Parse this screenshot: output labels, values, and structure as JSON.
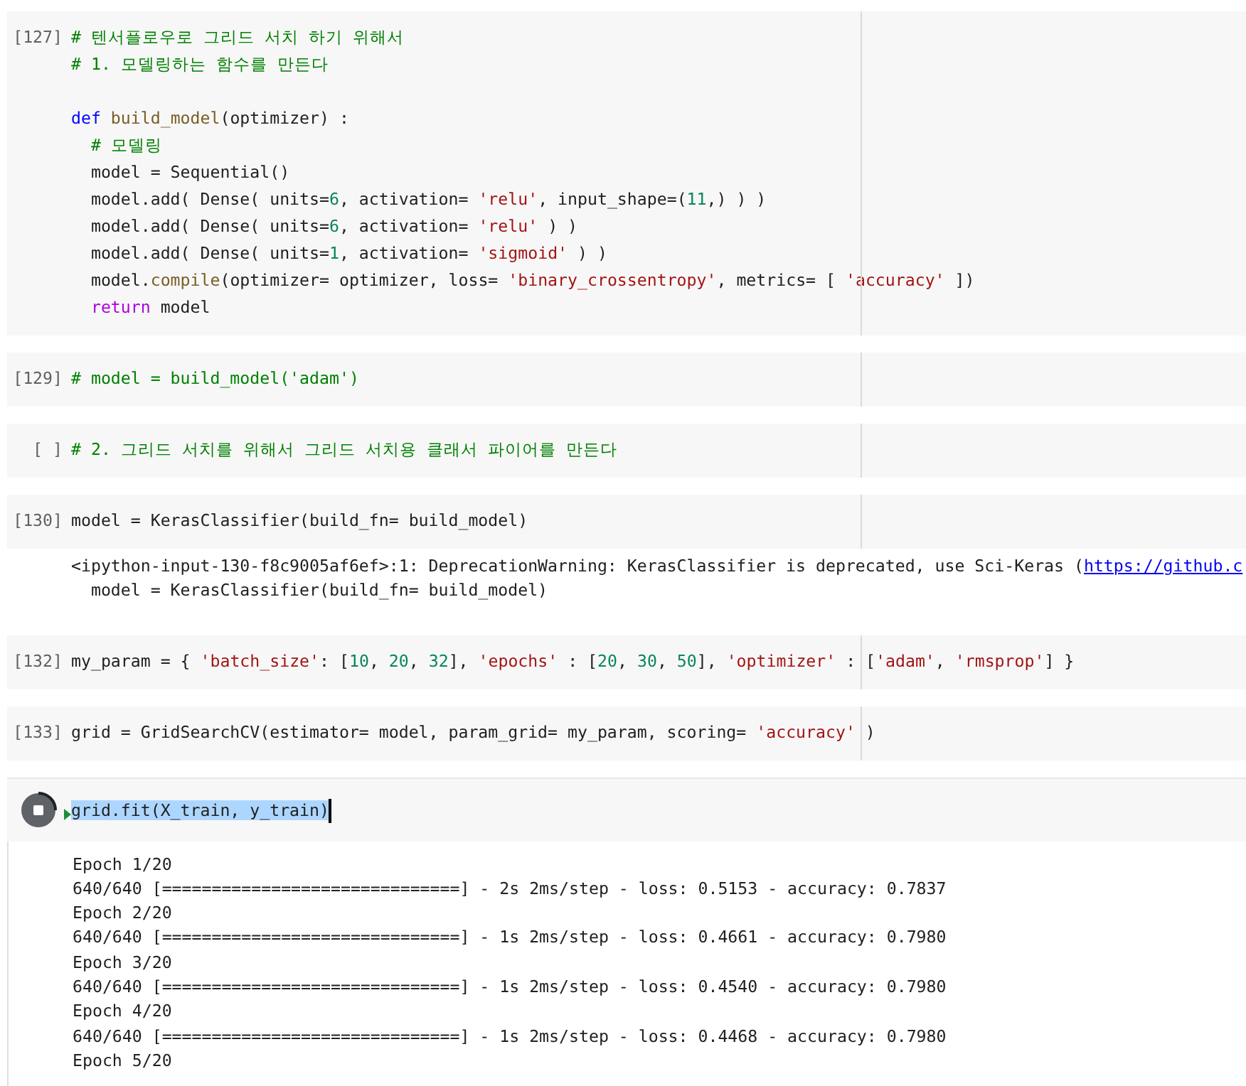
{
  "cells": [
    {
      "prompt": "[127]",
      "running": false,
      "lines": [
        {
          "tokens": [
            {
              "t": "# 텐서플로우로 그리드 서치 하기 위해서",
              "kind": "comment"
            }
          ]
        },
        {
          "tokens": [
            {
              "t": "# 1. 모델링하는 함수를 만든다",
              "kind": "comment"
            }
          ]
        },
        {
          "blank_before": true,
          "tokens": [
            {
              "t": "def",
              "kind": "keyword"
            },
            {
              "t": " build_model",
              "kind": "func"
            },
            {
              "t": "(optimizer) :",
              "kind": "plain"
            }
          ]
        },
        {
          "tokens": [
            {
              "t": "  # 모델링",
              "kind": "comment"
            }
          ]
        },
        {
          "tokens": [
            {
              "t": "  model = Sequential()",
              "kind": "plain"
            }
          ]
        },
        {
          "tokens": [
            {
              "t": "  model.add( Dense( units=",
              "kind": "plain"
            },
            {
              "t": "6",
              "kind": "number"
            },
            {
              "t": ", activation= ",
              "kind": "plain"
            },
            {
              "t": "'relu'",
              "kind": "string"
            },
            {
              "t": ", input_shape=(",
              "kind": "plain"
            },
            {
              "t": "11",
              "kind": "number"
            },
            {
              "t": ",) ) )",
              "kind": "plain"
            }
          ]
        },
        {
          "tokens": [
            {
              "t": "  model.add( Dense( units=",
              "kind": "plain"
            },
            {
              "t": "6",
              "kind": "number"
            },
            {
              "t": ", activation= ",
              "kind": "plain"
            },
            {
              "t": "'relu'",
              "kind": "string"
            },
            {
              "t": " ) )",
              "kind": "plain"
            }
          ]
        },
        {
          "tokens": [
            {
              "t": "  model.add( Dense( units=",
              "kind": "plain"
            },
            {
              "t": "1",
              "kind": "number"
            },
            {
              "t": ", activation= ",
              "kind": "plain"
            },
            {
              "t": "'sigmoid'",
              "kind": "string"
            },
            {
              "t": " ) )",
              "kind": "plain"
            }
          ]
        },
        {
          "tokens": [
            {
              "t": "  model.",
              "kind": "plain"
            },
            {
              "t": "compile",
              "kind": "func"
            },
            {
              "t": "(optimizer= optimizer, loss= ",
              "kind": "plain"
            },
            {
              "t": "'binary_crossentropy'",
              "kind": "string"
            },
            {
              "t": ", metrics= [ ",
              "kind": "plain"
            },
            {
              "t": "'accuracy'",
              "kind": "string"
            },
            {
              "t": " ])",
              "kind": "plain"
            }
          ]
        },
        {
          "tokens": [
            {
              "t": "  return",
              "kind": "return"
            },
            {
              "t": " model",
              "kind": "plain"
            }
          ]
        }
      ]
    },
    {
      "prompt": "[129]",
      "running": false,
      "lines": [
        {
          "tokens": [
            {
              "t": "# model = build_model('adam')",
              "kind": "comment"
            }
          ]
        }
      ]
    },
    {
      "prompt": "[ ]",
      "running": false,
      "lines": [
        {
          "tokens": [
            {
              "t": "# 2. 그리드 서치를 위해서 그리드 서치용 클래서 파이어를 만든다",
              "kind": "comment"
            }
          ]
        }
      ]
    },
    {
      "prompt": "[130]",
      "running": false,
      "lines": [
        {
          "tokens": [
            {
              "t": "model = KerasClassifier(build_fn= build_model)",
              "kind": "plain"
            }
          ]
        }
      ],
      "output": [
        [
          {
            "t": "<ipython-input-130-f8c9005af6ef>:1: DeprecationWarning: KerasClassifier is deprecated, use Sci-Keras (",
            "kind": "plain"
          },
          {
            "t": "https://github.c",
            "kind": "link"
          }
        ],
        [
          {
            "t": "  model = KerasClassifier(build_fn= build_model)",
            "kind": "plain"
          }
        ]
      ]
    },
    {
      "prompt": "[132]",
      "running": false,
      "lines": [
        {
          "tokens": [
            {
              "t": "my_param = { ",
              "kind": "plain"
            },
            {
              "t": "'batch_size'",
              "kind": "string"
            },
            {
              "t": ": [",
              "kind": "plain"
            },
            {
              "t": "10",
              "kind": "number"
            },
            {
              "t": ", ",
              "kind": "plain"
            },
            {
              "t": "20",
              "kind": "number"
            },
            {
              "t": ", ",
              "kind": "plain"
            },
            {
              "t": "32",
              "kind": "number"
            },
            {
              "t": "], ",
              "kind": "plain"
            },
            {
              "t": "'epochs'",
              "kind": "string"
            },
            {
              "t": " : [",
              "kind": "plain"
            },
            {
              "t": "20",
              "kind": "number"
            },
            {
              "t": ", ",
              "kind": "plain"
            },
            {
              "t": "30",
              "kind": "number"
            },
            {
              "t": ", ",
              "kind": "plain"
            },
            {
              "t": "50",
              "kind": "number"
            },
            {
              "t": "], ",
              "kind": "plain"
            },
            {
              "t": "'optimizer'",
              "kind": "string"
            },
            {
              "t": " : [",
              "kind": "plain"
            },
            {
              "t": "'adam'",
              "kind": "string"
            },
            {
              "t": ", ",
              "kind": "plain"
            },
            {
              "t": "'rmsprop'",
              "kind": "string"
            },
            {
              "t": "] }",
              "kind": "plain"
            }
          ]
        }
      ]
    },
    {
      "prompt": "[133]",
      "running": false,
      "lines": [
        {
          "tokens": [
            {
              "t": "grid = GridSearchCV(estimator= model, param_grid= my_param, scoring= ",
              "kind": "plain"
            },
            {
              "t": "'accuracy'",
              "kind": "string"
            },
            {
              "t": " )",
              "kind": "plain"
            }
          ]
        }
      ]
    },
    {
      "running": true,
      "lines": [
        {
          "tokens": [
            {
              "t": "grid.fit(X_train, y_train)",
              "kind": "selected"
            }
          ]
        }
      ],
      "output": [
        [
          {
            "t": "Epoch 1/20",
            "kind": "plain"
          }
        ],
        [
          {
            "t": "640/640 [==============================] - 2s 2ms/step - loss: 0.5153 - accuracy: 0.7837",
            "kind": "plain"
          }
        ],
        [
          {
            "t": "Epoch 2/20",
            "kind": "plain"
          }
        ],
        [
          {
            "t": "640/640 [==============================] - 1s 2ms/step - loss: 0.4661 - accuracy: 0.7980",
            "kind": "plain"
          }
        ],
        [
          {
            "t": "Epoch 3/20",
            "kind": "plain"
          }
        ],
        [
          {
            "t": "640/640 [==============================] - 1s 2ms/step - loss: 0.4540 - accuracy: 0.7980",
            "kind": "plain"
          }
        ],
        [
          {
            "t": "Epoch 4/20",
            "kind": "plain"
          }
        ],
        [
          {
            "t": "640/640 [==============================] - 1s 2ms/step - loss: 0.4468 - accuracy: 0.7980",
            "kind": "plain"
          }
        ],
        [
          {
            "t": "Epoch 5/20",
            "kind": "plain"
          }
        ]
      ]
    }
  ]
}
